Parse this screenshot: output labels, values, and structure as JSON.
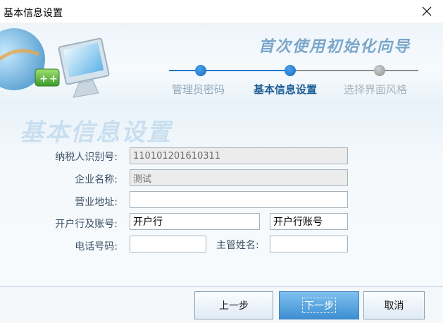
{
  "window": {
    "title": "基本信息设置"
  },
  "banner": {
    "wizard_title": "首次使用初始化向导",
    "steps": [
      {
        "label": "管理员密码",
        "state": "past"
      },
      {
        "label": "基本信息设置",
        "state": "current"
      },
      {
        "label": "选择界面风格",
        "state": "future"
      }
    ]
  },
  "section": {
    "watermark_title": "基本信息设置"
  },
  "form": {
    "taxpayer_id": {
      "label": "纳税人识别号:",
      "value": "110101201610311"
    },
    "company_name": {
      "label": "企业名称:",
      "value": "测试"
    },
    "address": {
      "label": "营业地址:",
      "value": ""
    },
    "bank": {
      "label": "开户行及账号:",
      "bank_value": "开户行",
      "account_value": "开户行账号"
    },
    "phone": {
      "label": "电话号码:",
      "value": ""
    },
    "manager": {
      "label": "主管姓名:",
      "value": ""
    }
  },
  "footer": {
    "prev_label": "上一步",
    "next_label": "下一步",
    "cancel_label": "取消"
  },
  "colors": {
    "accent": "#1f79c9",
    "primary_button": "#3d8fd2",
    "watermark": "#c9dff0"
  },
  "icons": {
    "close": "close-icon",
    "banner_graphic": "computer-monitor-icon"
  }
}
